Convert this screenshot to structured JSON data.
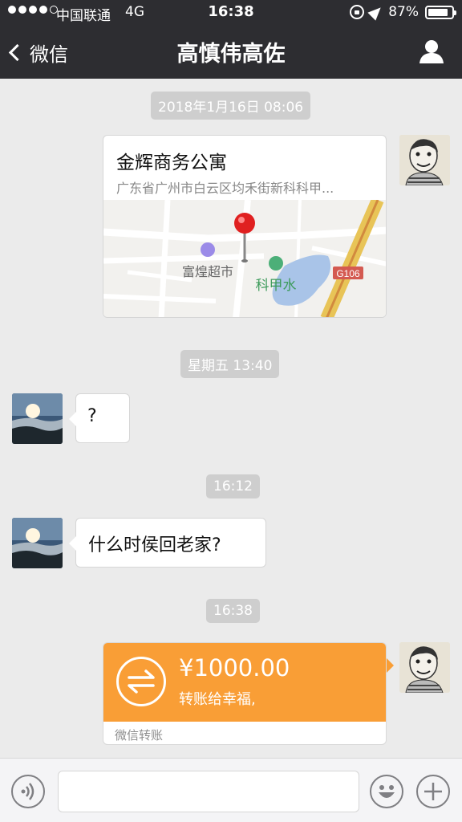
{
  "status_bar": {
    "carrier": "中国联通",
    "network": "4G",
    "time": "16:38",
    "battery": "87%",
    "battery_level": 0.87
  },
  "nav": {
    "back_label": "微信",
    "title": "高慎伟高佐",
    "profile_icon": "person-icon"
  },
  "messages": [
    {
      "type": "timestamp",
      "text": "2018年1月16日 08:06"
    },
    {
      "type": "location",
      "sender": "self",
      "name": "金辉商务公寓",
      "address": "广东省广州市白云区均禾街新科科甲...",
      "map_labels": {
        "poi_1": "富煌超市",
        "poi_2": "科甲水",
        "road": "G106"
      }
    },
    {
      "type": "timestamp",
      "text": "星期五 13:40"
    },
    {
      "type": "text",
      "sender": "other",
      "text": "?"
    },
    {
      "type": "timestamp",
      "text": "16:12"
    },
    {
      "type": "text",
      "sender": "other",
      "text": "什么时侯回老家?"
    },
    {
      "type": "timestamp",
      "text": "16:38"
    },
    {
      "type": "transfer",
      "sender": "self",
      "amount": "¥1000.00",
      "note": "转账给幸福,",
      "footer": "微信转账"
    }
  ],
  "input_bar": {
    "voice_icon": "voice-icon",
    "emoji_icon": "emoji-icon",
    "more_icon": "plus-icon",
    "placeholder": ""
  },
  "colors": {
    "nav_bg": "#2d2d31",
    "chat_bg": "#ebebeb",
    "transfer_orange": "#f99e36",
    "timestamp_bg": "#cecece"
  }
}
